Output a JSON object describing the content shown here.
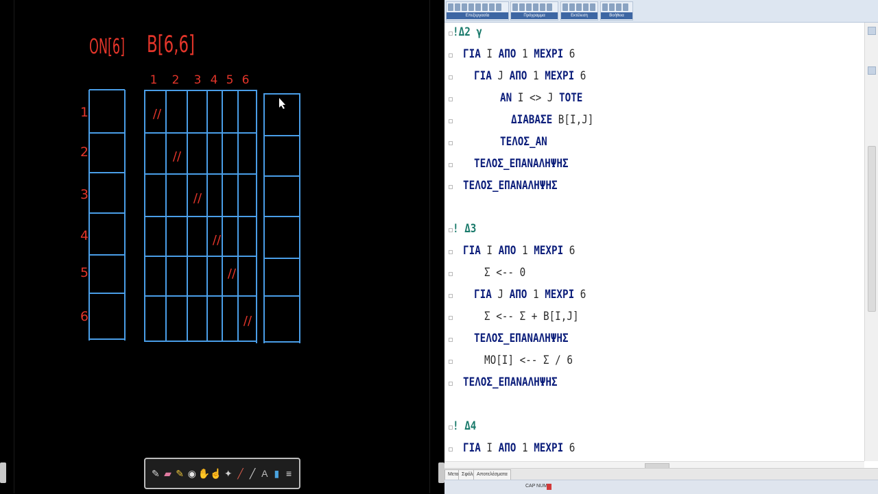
{
  "board": {
    "notes": {
      "left_array": "ON[6]",
      "right_array": "B[6,6]"
    },
    "column_numbers": [
      "1",
      "2",
      "3",
      "4",
      "5",
      "6"
    ],
    "row_numbers": [
      "1",
      "2",
      "3",
      "4",
      "5",
      "6"
    ],
    "diagonal_mark": "//",
    "palette_tools": [
      "pen-icon",
      "eraser-icon",
      "highlighter-icon",
      "disc-icon",
      "hand-icon",
      "pointer-icon",
      "wand-icon",
      "brush-icon",
      "line-icon",
      "text-icon",
      "save-icon",
      "menu-icon"
    ]
  },
  "editor": {
    "ribbon_groups": [
      "Επεξεργασία",
      "Πρόγραμμα",
      "Εκτέλεση",
      "Βοήθεια"
    ],
    "code_lines": [
      {
        "indent": 0,
        "parts": [
          {
            "t": "!Δ2 γ",
            "c": "ct"
          }
        ]
      },
      {
        "indent": 1,
        "parts": [
          {
            "t": "ΓΙΑ",
            "c": "kw"
          },
          {
            "t": " Ι ",
            "c": "tx"
          },
          {
            "t": "ΑΠΟ",
            "c": "kw"
          },
          {
            "t": " 1 ",
            "c": "tx"
          },
          {
            "t": "ΜΕΧΡΙ",
            "c": "kw"
          },
          {
            "t": " 6",
            "c": "tx"
          }
        ]
      },
      {
        "indent": 2,
        "parts": [
          {
            "t": "ΓΙΑ",
            "c": "kw"
          },
          {
            "t": " J ",
            "c": "tx"
          },
          {
            "t": "ΑΠΟ",
            "c": "kw"
          },
          {
            "t": " 1 ",
            "c": "tx"
          },
          {
            "t": "ΜΕΧΡΙ",
            "c": "kw"
          },
          {
            "t": " 6",
            "c": "tx"
          }
        ]
      },
      {
        "indent": 3,
        "parts": [
          {
            "t": "ΑΝ",
            "c": "kw"
          },
          {
            "t": " Ι <> J ",
            "c": "tx"
          },
          {
            "t": "ΤΟΤΕ",
            "c": "kw"
          }
        ]
      },
      {
        "indent": 4,
        "parts": [
          {
            "t": "ΔΙΑΒΑΣΕ",
            "c": "kw"
          },
          {
            "t": " B[I,J]",
            "c": "tx"
          }
        ]
      },
      {
        "indent": 3,
        "parts": [
          {
            "t": "ΤΕΛΟΣ_ΑΝ",
            "c": "kw"
          }
        ]
      },
      {
        "indent": 2,
        "parts": [
          {
            "t": "ΤΕΛΟΣ_ΕΠΑΝΑΛΗΨΗΣ",
            "c": "kw"
          }
        ]
      },
      {
        "indent": 1,
        "parts": [
          {
            "t": "ΤΕΛΟΣ_ΕΠΑΝΑΛΗΨΗΣ",
            "c": "kw"
          }
        ]
      },
      {
        "indent": 0,
        "parts": []
      },
      {
        "indent": 0,
        "parts": [
          {
            "t": "! Δ3",
            "c": "ct"
          }
        ]
      },
      {
        "indent": 1,
        "parts": [
          {
            "t": "ΓΙΑ",
            "c": "kw"
          },
          {
            "t": " Ι ",
            "c": "tx"
          },
          {
            "t": "ΑΠΟ",
            "c": "kw"
          },
          {
            "t": " 1 ",
            "c": "tx"
          },
          {
            "t": "ΜΕΧΡΙ",
            "c": "kw"
          },
          {
            "t": " 6",
            "c": "tx"
          }
        ]
      },
      {
        "indent": 3,
        "parts": [
          {
            "t": "Σ <-- 0",
            "c": "tx"
          }
        ]
      },
      {
        "indent": 2,
        "parts": [
          {
            "t": "ΓΙΑ",
            "c": "kw"
          },
          {
            "t": " J ",
            "c": "tx"
          },
          {
            "t": "ΑΠΟ",
            "c": "kw"
          },
          {
            "t": " 1 ",
            "c": "tx"
          },
          {
            "t": "ΜΕΧΡΙ",
            "c": "kw"
          },
          {
            "t": " 6",
            "c": "tx"
          }
        ]
      },
      {
        "indent": 3,
        "parts": [
          {
            "t": "Σ <-- Σ + B[I,J]",
            "c": "tx"
          }
        ]
      },
      {
        "indent": 2,
        "parts": [
          {
            "t": "ΤΕΛΟΣ_ΕΠΑΝΑΛΗΨΗΣ",
            "c": "kw"
          }
        ]
      },
      {
        "indent": 3,
        "parts": [
          {
            "t": "ΜΟ[Ι] <-- Σ / 6",
            "c": "tx"
          }
        ]
      },
      {
        "indent": 1,
        "parts": [
          {
            "t": "ΤΕΛΟΣ_ΕΠΑΝΑΛΗΨΗΣ",
            "c": "kw"
          }
        ]
      },
      {
        "indent": 0,
        "parts": []
      },
      {
        "indent": 0,
        "parts": [
          {
            "t": "! Δ4",
            "c": "ct"
          }
        ]
      },
      {
        "indent": 1,
        "parts": [
          {
            "t": "ΓΙΑ",
            "c": "kw"
          },
          {
            "t": " Ι ",
            "c": "tx"
          },
          {
            "t": "ΑΠΟ",
            "c": "kw"
          },
          {
            "t": " 1 ",
            "c": "tx"
          },
          {
            "t": "ΜΕΧΡΙ",
            "c": "kw"
          },
          {
            "t": " 6",
            "c": "tx"
          }
        ]
      }
    ],
    "tabs": [
      "Μεταφραστής",
      "Σφάλματα",
      "Αποτελέσματα"
    ],
    "status": {
      "cap": "CAP",
      "num": "NUM"
    }
  }
}
